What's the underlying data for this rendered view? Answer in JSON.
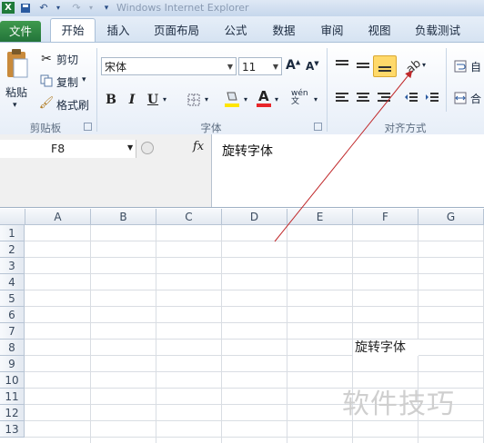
{
  "window": {
    "title": "Windows Internet Explorer"
  },
  "tabs": [
    "文件",
    "开始",
    "插入",
    "页面布局",
    "公式",
    "数据",
    "审阅",
    "视图",
    "负载测试"
  ],
  "clipboard": {
    "paste": "粘贴",
    "cut": "剪切",
    "copy": "复制",
    "format_painter": "格式刷",
    "group": "剪贴板"
  },
  "font": {
    "name": "宋体",
    "size": "11",
    "group": "字体",
    "bold": "B",
    "italic": "I",
    "underline": "U"
  },
  "alignment": {
    "group": "对齐方式",
    "wrap_partial": "自",
    "merge_partial": "合"
  },
  "formula_bar": {
    "cell_ref": "F8",
    "fx": "fx",
    "content": "旋转字体"
  },
  "columns": [
    "A",
    "B",
    "C",
    "D",
    "E",
    "F",
    "G"
  ],
  "rows": [
    "1",
    "2",
    "3",
    "4",
    "5",
    "6",
    "7",
    "8",
    "9",
    "10",
    "11",
    "12",
    "13"
  ],
  "cells": {
    "F8": "旋转字体"
  },
  "watermark": "软件技巧",
  "colors": {
    "accent_file": "#2f8a44",
    "font_color": "#e8262a",
    "fill_color": "#ffe500",
    "arrow": "#c0282a"
  }
}
